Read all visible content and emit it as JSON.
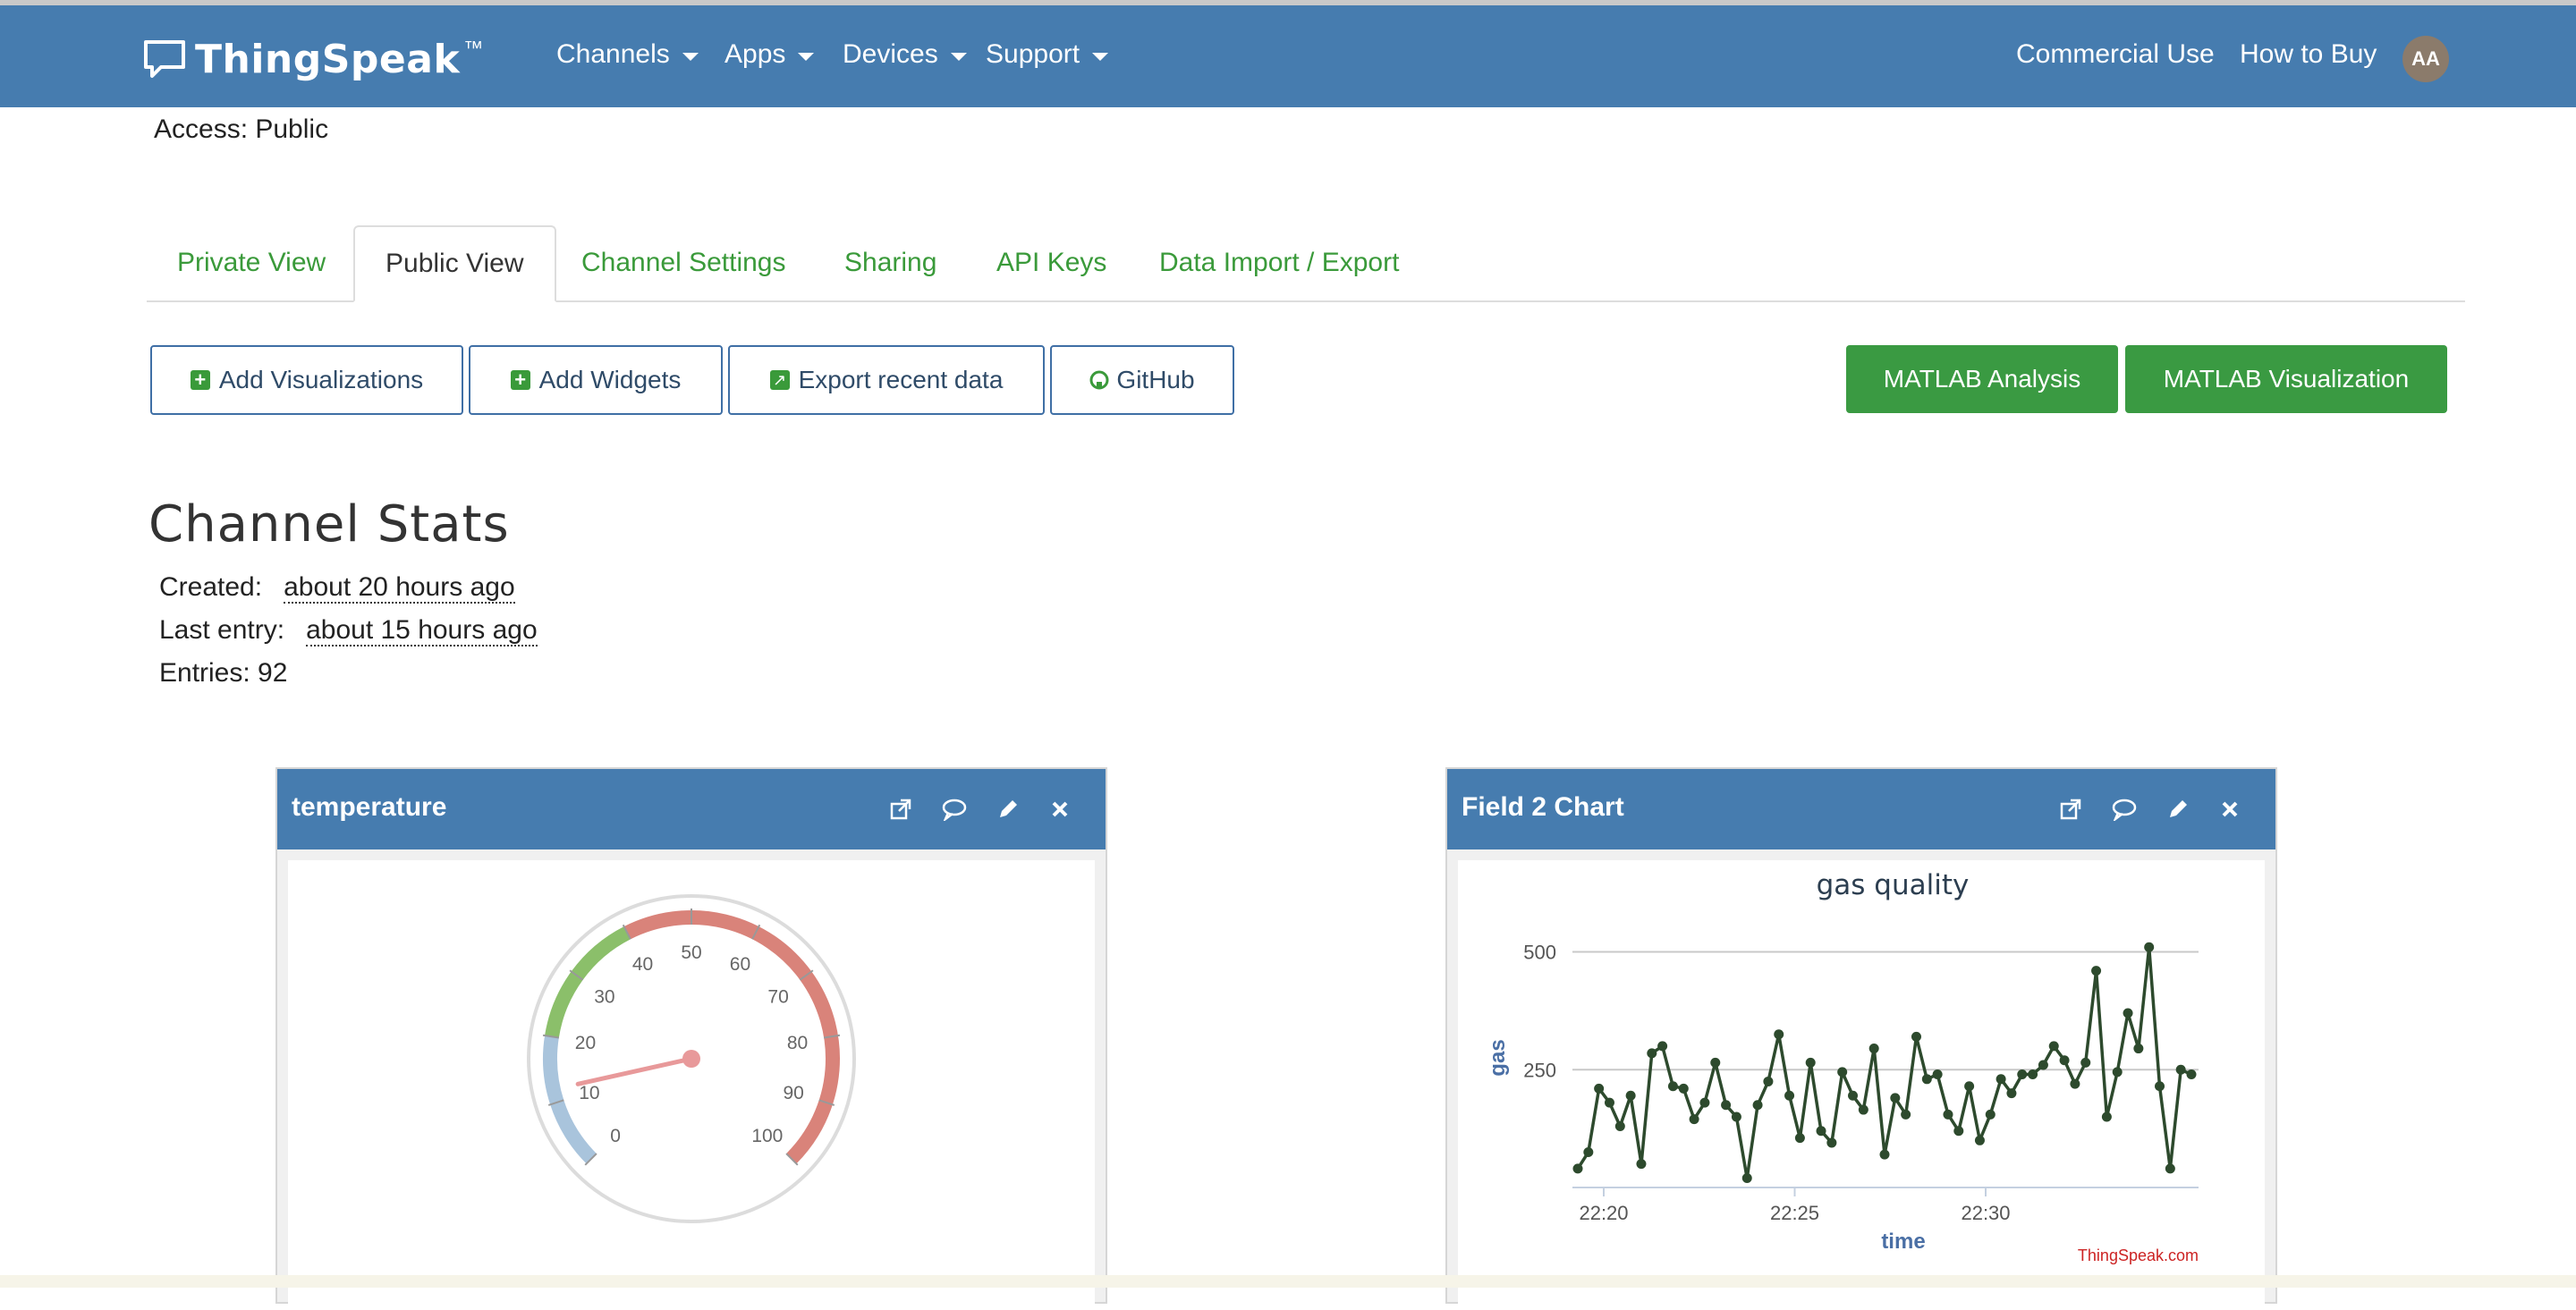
{
  "navbar": {
    "brand": "ThingSpeak",
    "brand_tm": "™",
    "menu": [
      "Channels",
      "Apps",
      "Devices",
      "Support"
    ],
    "right_links": [
      "Commercial Use",
      "How to Buy"
    ],
    "avatar_initials": "AA"
  },
  "channel": {
    "access": "Access: Public"
  },
  "tabs": [
    "Private View",
    "Public View",
    "Channel Settings",
    "Sharing",
    "API Keys",
    "Data Import / Export"
  ],
  "active_tab": "Public View",
  "actions": {
    "add_visualizations": "Add Visualizations",
    "add_widgets": "Add Widgets",
    "export_recent": "Export recent data",
    "github": "GitHub",
    "matlab_analysis": "MATLAB Analysis",
    "matlab_visualization": "MATLAB Visualization"
  },
  "stats": {
    "title": "Channel Stats",
    "created_label": "Created:",
    "created_value": "about 20 hours ago",
    "last_entry_label": "Last entry:",
    "last_entry_value": "about 15 hours ago",
    "entries": "Entries: 92"
  },
  "widgets": {
    "gauge_title": "temperature",
    "chart_title": "Field 2 Chart"
  },
  "gauge": {
    "min": 0,
    "max": 100,
    "value": 12,
    "ticks": [
      "0",
      "10",
      "20",
      "30",
      "40",
      "50",
      "60",
      "70",
      "80",
      "90",
      "100"
    ],
    "colors": {
      "low": "#a9c4dc",
      "mid": "#8bbf6a",
      "high": "#d9837a",
      "needle": "#e8999a"
    }
  },
  "chart_data": {
    "type": "line",
    "title": "gas quality",
    "xlabel": "time",
    "ylabel": "gas",
    "x_ticks": [
      "22:20",
      "22:25",
      "22:30"
    ],
    "y_ticks": [
      250,
      500
    ],
    "ylim": [
      0,
      520
    ],
    "credit": "ThingSpeak.com",
    "series": [
      {
        "color": "#2d4a2d",
        "values": [
          40,
          75,
          210,
          180,
          130,
          195,
          50,
          285,
          300,
          215,
          210,
          145,
          180,
          265,
          175,
          150,
          20,
          175,
          225,
          325,
          195,
          105,
          265,
          120,
          95,
          245,
          195,
          165,
          295,
          70,
          190,
          155,
          320,
          230,
          240,
          155,
          120,
          215,
          100,
          155,
          230,
          200,
          240,
          240,
          260,
          300,
          270,
          220,
          265,
          460,
          150,
          245,
          370,
          295,
          510,
          215,
          40,
          250,
          240
        ]
      }
    ]
  }
}
